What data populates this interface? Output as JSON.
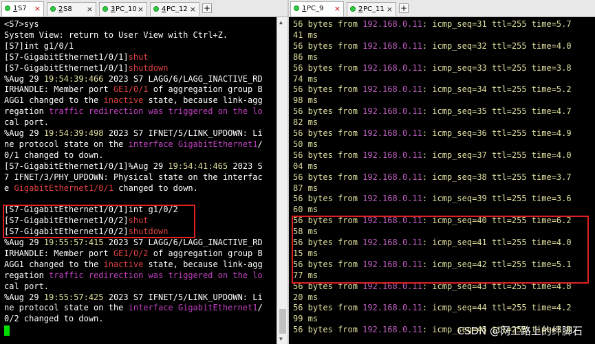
{
  "left_tabs": [
    {
      "num": "1",
      "name": "S7",
      "active": true,
      "close": "×"
    },
    {
      "num": "2",
      "name": "S8",
      "active": false,
      "close": "×"
    },
    {
      "num": "3",
      "name": "PC_10",
      "active": false,
      "close": "×"
    },
    {
      "num": "4",
      "name": "PC_12",
      "active": false,
      "close": "×"
    }
  ],
  "right_tabs": [
    {
      "num": "1",
      "name": "PC_9",
      "active": true,
      "close": "×"
    },
    {
      "num": "2",
      "name": "PC_11",
      "active": false,
      "close": "×"
    }
  ],
  "add_tab_label": "+",
  "scroll_up": "▲",
  "scroll_down": "▼",
  "left_lines": [
    [
      [
        "<S7>sys",
        "w"
      ]
    ],
    [
      [
        "System View: return to User View with Ctrl+Z.",
        "w"
      ]
    ],
    [
      [
        "[S7]int g1/0/1",
        "w"
      ]
    ],
    [
      [
        "[S7-GigabitEthernet1/0/1]",
        "w"
      ],
      [
        "shut",
        "r"
      ]
    ],
    [
      [
        "[S7-GigabitEthernet1/0/1]",
        "w"
      ],
      [
        "shutdown",
        "r"
      ]
    ],
    [
      [
        "%Aug 29 ",
        "w"
      ],
      [
        "19:54:39:466",
        "y"
      ],
      [
        " 2023 S7 LAGG/6/LAGG_INACTIVE_RD",
        "w"
      ]
    ],
    [
      [
        "IRHANDLE: Member port ",
        "w"
      ],
      [
        "GE1/0/1",
        "r"
      ],
      [
        " of aggregation group B",
        "w"
      ]
    ],
    [
      [
        "AGG1 changed to the ",
        "w"
      ],
      [
        "inactive",
        "r"
      ],
      [
        " state, because link-agg",
        "w"
      ]
    ],
    [
      [
        "regation ",
        "w"
      ],
      [
        "traffic redirection",
        "m"
      ],
      [
        " ",
        "w"
      ],
      [
        "was triggered on the lo",
        "m"
      ]
    ],
    [
      [
        "cal port.",
        "w"
      ]
    ],
    [
      [
        "%Aug 29 ",
        "w"
      ],
      [
        "19:54:39:498",
        "y"
      ],
      [
        " 2023 S7 IFNET/5/LINK_UPDOWN: Li",
        "w"
      ]
    ],
    [
      [
        "ne protocol state on the ",
        "w"
      ],
      [
        "interface GigabitEthernet1",
        "m"
      ],
      [
        "/",
        "w"
      ]
    ],
    [
      [
        "0/1 changed to down.",
        "w"
      ]
    ],
    [
      [
        "[S7-GigabitEthernet1/0/1]",
        "w"
      ],
      [
        "%Aug 29 ",
        "w"
      ],
      [
        "19:54:41:465",
        "y"
      ],
      [
        " 2023 S",
        "w"
      ]
    ],
    [
      [
        "7 IFNET/3/PHY_UPDOWN: Physical state on the interfac",
        "w"
      ]
    ],
    [
      [
        "e ",
        "w"
      ],
      [
        "GigabitEthernet1/0/1",
        "r"
      ],
      [
        " changed to down.",
        "w"
      ]
    ],
    [
      [
        "",
        "w"
      ]
    ],
    [
      [
        "[S7-GigabitEthernet1/0/1]",
        "w"
      ],
      [
        "int g1/0/2",
        "w"
      ]
    ],
    [
      [
        "[S7-GigabitEthernet1/0/2]",
        "w"
      ],
      [
        "shut",
        "r"
      ]
    ],
    [
      [
        "[S7-GigabitEthernet1/0/2]",
        "w"
      ],
      [
        "shutdown",
        "r"
      ]
    ],
    [
      [
        "%Aug 29 ",
        "w"
      ],
      [
        "19:55:57:415",
        "y"
      ],
      [
        " 2023 S7 LAGG/6/LAGG_INACTIVE_RD",
        "w"
      ]
    ],
    [
      [
        "IRHANDLE: Member port ",
        "w"
      ],
      [
        "GE1/0/2",
        "r"
      ],
      [
        " of aggregation group B",
        "w"
      ]
    ],
    [
      [
        "AGG1 changed to the ",
        "w"
      ],
      [
        "inactive",
        "r"
      ],
      [
        " state, because link-agg",
        "w"
      ]
    ],
    [
      [
        "regation ",
        "w"
      ],
      [
        "traffic redirection",
        "m"
      ],
      [
        " ",
        "w"
      ],
      [
        "was triggered on the lo",
        "m"
      ]
    ],
    [
      [
        "cal port.",
        "w"
      ]
    ],
    [
      [
        "%Aug 29 ",
        "w"
      ],
      [
        "19:55:57:425",
        "y"
      ],
      [
        " 2023 S7 IFNET/5/LINK_UPDOWN: Li",
        "w"
      ]
    ],
    [
      [
        "ne protocol state on the ",
        "w"
      ],
      [
        "interface GigabitEthernet1",
        "m"
      ],
      [
        "/",
        "w"
      ]
    ],
    [
      [
        "0/2 changed to down.",
        "w"
      ]
    ]
  ],
  "right_lines": [
    [
      [
        "56 bytes from ",
        "y"
      ],
      [
        "192.168.0.11",
        "ip"
      ],
      [
        ": icmp_seq=31 ttl=255 time=5.7",
        "y"
      ]
    ],
    [
      [
        "41 ms",
        "y"
      ]
    ],
    [
      [
        "56 bytes from ",
        "y"
      ],
      [
        "192.168.0.11",
        "ip"
      ],
      [
        ": icmp_seq=32 ttl=255 time=4.0",
        "y"
      ]
    ],
    [
      [
        "86 ms",
        "y"
      ]
    ],
    [
      [
        "56 bytes from ",
        "y"
      ],
      [
        "192.168.0.11",
        "ip"
      ],
      [
        ": icmp_seq=33 ttl=255 time=3.8",
        "y"
      ]
    ],
    [
      [
        "74 ms",
        "y"
      ]
    ],
    [
      [
        "56 bytes from ",
        "y"
      ],
      [
        "192.168.0.11",
        "ip"
      ],
      [
        ": icmp_seq=34 ttl=255 time=5.2",
        "y"
      ]
    ],
    [
      [
        "98 ms",
        "y"
      ]
    ],
    [
      [
        "56 bytes from ",
        "y"
      ],
      [
        "192.168.0.11",
        "ip"
      ],
      [
        ": icmp_seq=35 ttl=255 time=4.7",
        "y"
      ]
    ],
    [
      [
        "82 ms",
        "y"
      ]
    ],
    [
      [
        "56 bytes from ",
        "y"
      ],
      [
        "192.168.0.11",
        "ip"
      ],
      [
        ": icmp_seq=36 ttl=255 time=4.9",
        "y"
      ]
    ],
    [
      [
        "50 ms",
        "y"
      ]
    ],
    [
      [
        "56 bytes from ",
        "y"
      ],
      [
        "192.168.0.11",
        "ip"
      ],
      [
        ": icmp_seq=37 ttl=255 time=4.0",
        "y"
      ]
    ],
    [
      [
        "04 ms",
        "y"
      ]
    ],
    [
      [
        "56 bytes from ",
        "y"
      ],
      [
        "192.168.0.11",
        "ip"
      ],
      [
        ": icmp_seq=38 ttl=255 time=3.7",
        "y"
      ]
    ],
    [
      [
        "87 ms",
        "y"
      ]
    ],
    [
      [
        "56 bytes from ",
        "y"
      ],
      [
        "192.168.0.11",
        "ip"
      ],
      [
        ": icmp_seq=39 ttl=255 time=3.6",
        "y"
      ]
    ],
    [
      [
        "60 ms",
        "y"
      ]
    ],
    [
      [
        "56 bytes from ",
        "y"
      ],
      [
        "192.168.0.11",
        "ip"
      ],
      [
        ": icmp_seq=40 ttl=255 time=6.2",
        "y"
      ]
    ],
    [
      [
        "58 ms",
        "y"
      ]
    ],
    [
      [
        "56 bytes from ",
        "y"
      ],
      [
        "192.168.0.11",
        "ip"
      ],
      [
        ": icmp_seq=41 ttl=255 time=4.0",
        "y"
      ]
    ],
    [
      [
        "15 ms",
        "y"
      ]
    ],
    [
      [
        "56 bytes from ",
        "y"
      ],
      [
        "192.168.0.11",
        "ip"
      ],
      [
        ": icmp_seq=42 ttl=255 time=5.1",
        "y"
      ]
    ],
    [
      [
        "77 ms",
        "y"
      ]
    ],
    [
      [
        "56 bytes from ",
        "y"
      ],
      [
        "192.168.0.11",
        "ip"
      ],
      [
        ": icmp_seq=43 ttl=255 time=4.8",
        "y"
      ]
    ],
    [
      [
        "20 ms",
        "y"
      ]
    ],
    [
      [
        "56 bytes from ",
        "y"
      ],
      [
        "192.168.0.11",
        "ip"
      ],
      [
        ": icmp_seq=44 ttl=255 time=4.2",
        "y"
      ]
    ],
    [
      [
        "99 ms",
        "y"
      ]
    ],
    [
      [
        "56 bytes from ",
        "y"
      ],
      [
        "192.168.0.11",
        "ip"
      ],
      [
        ": icmp_seq=45 ttl=255 time=3.8",
        "y"
      ]
    ]
  ],
  "watermark": "CSDN @网工路上的绊脚石",
  "colors": {
    "highlight": "#e02020",
    "cursor": "#00dd00",
    "tab_led": "#2ecc40",
    "terminal_bg": "#000000"
  }
}
